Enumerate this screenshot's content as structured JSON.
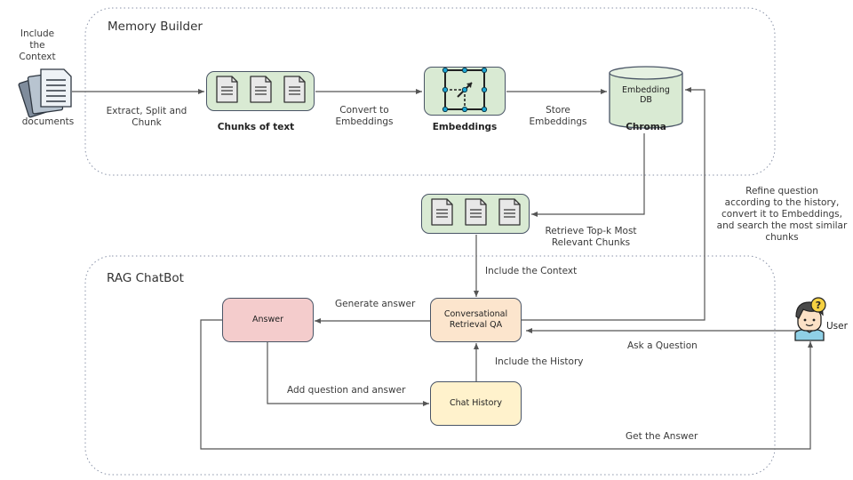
{
  "groups": {
    "memory_builder": "Memory Builder",
    "rag_chatbot": "RAG ChatBot"
  },
  "documents": {
    "top_label": "Include the Context",
    "top_lines": [
      "Include",
      "the",
      "Context"
    ],
    "label": "documents",
    "icon": "documents-icon"
  },
  "edges": {
    "extract": [
      "Extract, Split and",
      "Chunk"
    ],
    "convert": [
      "Convert to",
      "Embeddings"
    ],
    "store": [
      "Store",
      "Embeddings"
    ],
    "retrieve": [
      "Retrieve Top-k Most",
      "Relevant Chunks"
    ],
    "include_context": "Include the Context",
    "refine": [
      "Refine question",
      "according to the history,",
      "convert it to Embeddings,",
      "and search the most similar",
      "chunks"
    ],
    "generate": "Generate answer",
    "ask": "Ask a Question",
    "include_history": "Include the History",
    "add_qa": "Add question and  answer",
    "get_answer": "Get the Answer"
  },
  "nodes": {
    "chunks": {
      "label": "Chunks of text",
      "icon": "document-chunk-icon"
    },
    "embeddings": {
      "label": "Embeddings",
      "icon": "vector-grid-icon"
    },
    "db": {
      "lines": [
        "Embedding",
        "DB"
      ],
      "label": "Chroma",
      "icon": "database-cylinder-icon"
    },
    "retrieved": {
      "icon": "document-chunk-icon"
    },
    "answer": {
      "label": "Answer"
    },
    "crqa": {
      "lines": [
        "Conversational",
        "Retrieval QA"
      ]
    },
    "history": {
      "label": "Chat History"
    },
    "user": {
      "label": "User",
      "icon": "user-question-icon"
    }
  },
  "colors": {
    "green_fill": "#d9ead3",
    "answer_fill": "#f4cccc",
    "crqa_fill": "#fce5cd",
    "history_fill": "#fff2cc",
    "stroke": "#4a5566",
    "line": "#555555",
    "dot_accent": "#1ea7d6",
    "user_badge": "#f5d142"
  }
}
